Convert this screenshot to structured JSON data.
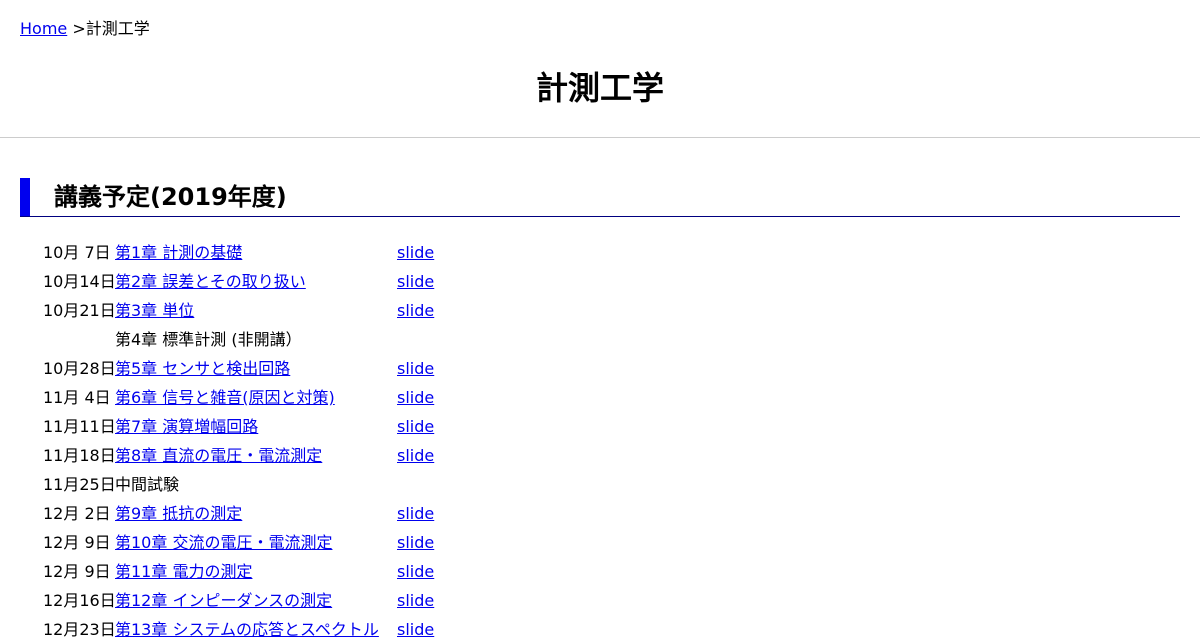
{
  "breadcrumb": {
    "home_label": "Home",
    "separator": ">",
    "current": "計測工学"
  },
  "page_title": "計測工学",
  "section": {
    "title": "講義予定(2019年度)"
  },
  "schedule": [
    {
      "date": "10月 7日",
      "topic": "第1章 計測の基礎",
      "topic_link": true,
      "slide": "slide"
    },
    {
      "date": "10月14日",
      "topic": "第2章 誤差とその取り扱い",
      "topic_link": true,
      "slide": "slide"
    },
    {
      "date": "10月21日",
      "topic": "第3章 単位",
      "topic_link": true,
      "slide": "slide"
    },
    {
      "date": "",
      "topic": "第4章 標準計測 (非開講）",
      "topic_link": false,
      "slide": ""
    },
    {
      "date": "10月28日",
      "topic": "第5章 センサと検出回路",
      "topic_link": true,
      "slide": "slide"
    },
    {
      "date": "11月 4日",
      "topic": "第6章 信号と雑音(原因と対策)",
      "topic_link": true,
      "slide": "slide"
    },
    {
      "date": "11月11日",
      "topic": "第7章 演算増幅回路",
      "topic_link": true,
      "slide": "slide"
    },
    {
      "date": "11月18日",
      "topic": "第8章 直流の電圧・電流測定",
      "topic_link": true,
      "slide": "slide"
    },
    {
      "date": "11月25日",
      "topic": "中間試験",
      "topic_link": false,
      "slide": ""
    },
    {
      "date": "12月 2日",
      "topic": "第9章 抵抗の測定",
      "topic_link": true,
      "slide": "slide"
    },
    {
      "date": "12月 9日",
      "topic": "第10章 交流の電圧・電流測定",
      "topic_link": true,
      "slide": "slide"
    },
    {
      "date": "12月 9日",
      "topic": "第11章 電力の測定",
      "topic_link": true,
      "slide": "slide"
    },
    {
      "date": "12月16日",
      "topic": "第12章 インピーダンスの測定",
      "topic_link": true,
      "slide": "slide"
    },
    {
      "date": "12月23日",
      "topic": "第13章 システムの応答とスペクトル",
      "topic_link": true,
      "slide": "slide"
    }
  ]
}
